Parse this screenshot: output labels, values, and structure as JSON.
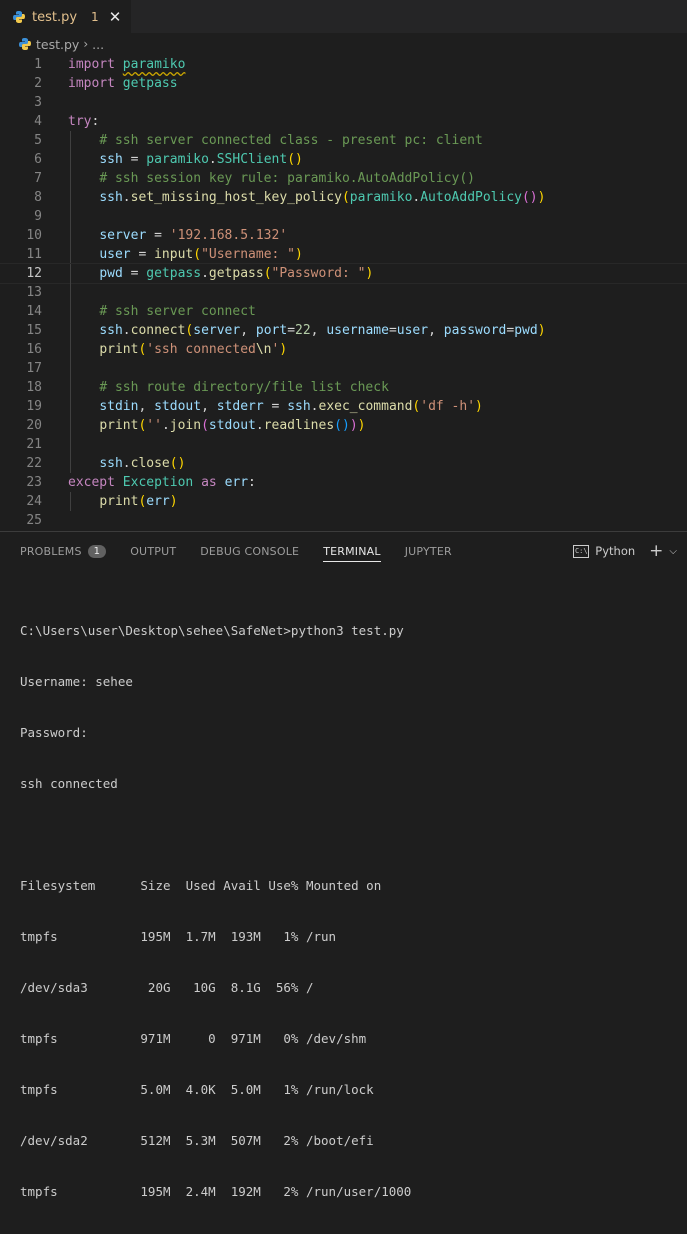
{
  "tab": {
    "name": "test.py",
    "problems_count": "1",
    "close": "✕"
  },
  "breadcrumb": {
    "file": "test.py",
    "sep": "›",
    "more": "..."
  },
  "editor": {
    "lines": [
      {
        "n": "1"
      },
      {
        "n": "2"
      },
      {
        "n": "3"
      },
      {
        "n": "4"
      },
      {
        "n": "5"
      },
      {
        "n": "6"
      },
      {
        "n": "7"
      },
      {
        "n": "8"
      },
      {
        "n": "9"
      },
      {
        "n": "10"
      },
      {
        "n": "11"
      },
      {
        "n": "12"
      },
      {
        "n": "13"
      },
      {
        "n": "14"
      },
      {
        "n": "15"
      },
      {
        "n": "16"
      },
      {
        "n": "17"
      },
      {
        "n": "18"
      },
      {
        "n": "19"
      },
      {
        "n": "20"
      },
      {
        "n": "21"
      },
      {
        "n": "22"
      },
      {
        "n": "23"
      },
      {
        "n": "24"
      },
      {
        "n": "25"
      }
    ]
  },
  "panel": {
    "tabs": {
      "problems": "PROBLEMS",
      "problems_badge": "1",
      "output": "OUTPUT",
      "debug": "DEBUG CONSOLE",
      "terminal": "TERMINAL",
      "jupyter": "JUPYTER"
    },
    "shell": "Python",
    "terminal_lines": [
      "C:\\Users\\user\\Desktop\\sehee\\SafeNet>python3 test.py",
      "Username: sehee",
      "Password:",
      "ssh connected",
      "",
      "Filesystem      Size  Used Avail Use% Mounted on",
      "tmpfs           195M  1.7M  193M   1% /run",
      "/dev/sda3        20G   10G  8.1G  56% /",
      "tmpfs           971M     0  971M   0% /dev/shm",
      "tmpfs           5.0M  4.0K  5.0M   1% /run/lock",
      "/dev/sda2       512M  5.3M  507M   2% /boot/efi",
      "tmpfs           195M  2.4M  192M   2% /run/user/1000"
    ]
  }
}
